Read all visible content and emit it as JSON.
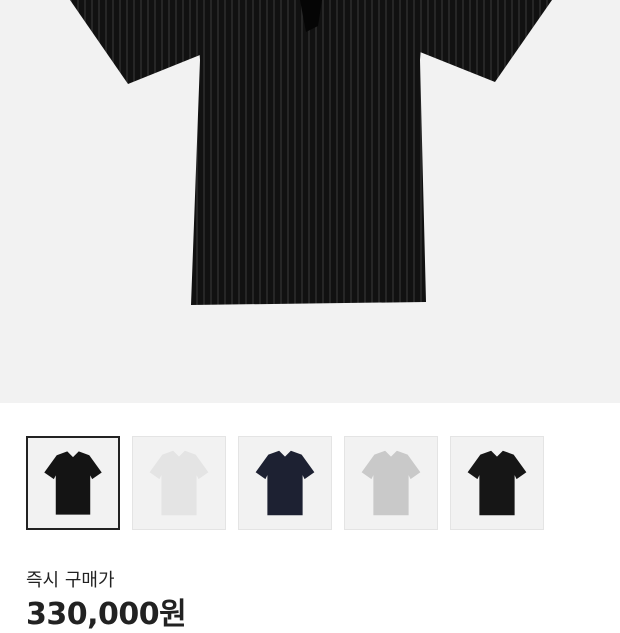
{
  "product": {
    "main_image": {
      "icon": "black-pleated-polo-shirt-image",
      "color": "#111111"
    },
    "thumbnails": [
      {
        "icon": "black-polo-thumbnail",
        "color": "#141414",
        "selected": true
      },
      {
        "icon": "white-polo-thumbnail",
        "color": "#e4e4e4",
        "selected": false
      },
      {
        "icon": "navy-polo-thumbnail",
        "color": "#1d2132",
        "selected": false
      },
      {
        "icon": "light-gray-polo-thumbnail",
        "color": "#c9c9c9",
        "selected": false
      },
      {
        "icon": "black-polo-thumbnail-alt",
        "color": "#161616",
        "selected": false
      }
    ]
  },
  "purchase": {
    "label": "즉시 구매가",
    "price": "330,000원"
  }
}
